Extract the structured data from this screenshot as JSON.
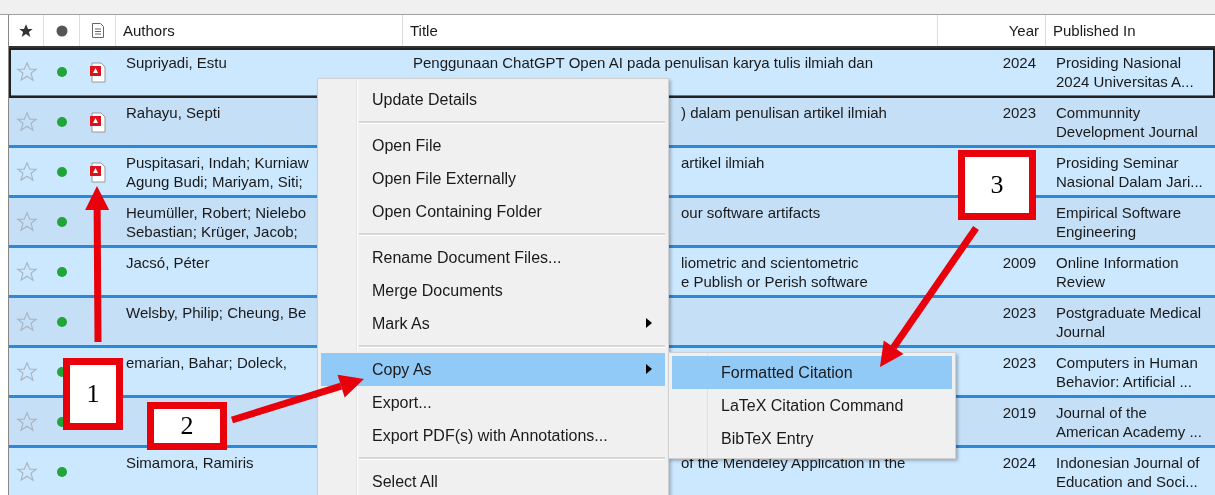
{
  "columns": [
    "Authors",
    "Title",
    "Year",
    "Published In"
  ],
  "rows": [
    {
      "selected": true,
      "focused": true,
      "starred": false,
      "unread": true,
      "pdf": true,
      "authors": "Supriyadi, Estu",
      "title": "Penggunaan ChatGPT Open AI pada penulisan karya tulis ilmiah dan",
      "year": "2024",
      "published_in": "Prosiding Nasional\n2024 Universitas A..."
    },
    {
      "selected": true,
      "focused": false,
      "starred": false,
      "unread": true,
      "pdf": true,
      "authors": "Rahayu, Septi",
      "title": ") dalam penulisan artikel ilmiah",
      "year": "2023",
      "published_in": "Communnity\nDevelopment Journal"
    },
    {
      "selected": true,
      "focused": false,
      "starred": false,
      "unread": true,
      "pdf": true,
      "authors": "Puspitasari, Indah; Kurniaw\nAgung Budi; Mariyam, Siti;",
      "title": "artikel ilmiah",
      "published_in": "Prosiding Seminar\nNasional Dalam Jari..."
    },
    {
      "selected": true,
      "focused": false,
      "starred": false,
      "unread": true,
      "pdf": false,
      "authors": "Heumüller, Robert; Nielebo\nSebastian; Krüger, Jacob;",
      "title": "our software artifacts",
      "published_in": "Empirical Software\nEngineering"
    },
    {
      "selected": true,
      "focused": false,
      "starred": false,
      "unread": true,
      "pdf": false,
      "authors": "Jacsó, Péter",
      "title": "liometric and scientometric\ne Publish or Perish software",
      "year": "2009",
      "published_in": "Online Information\nReview"
    },
    {
      "selected": true,
      "focused": false,
      "starred": false,
      "unread": true,
      "pdf": false,
      "authors": "Welsby, Philip; Cheung, Be",
      "year": "2023",
      "published_in": "Postgraduate Medical\nJournal"
    },
    {
      "selected": true,
      "focused": false,
      "starred": false,
      "unread": true,
      "pdf": false,
      "authors": "emarian, Bahar; Doleck,",
      "year": "2023",
      "published_in": "Computers in Human\nBehavior: Artificial ..."
    },
    {
      "selected": true,
      "focused": false,
      "starred": false,
      "unread": true,
      "pdf": false,
      "year": "2019",
      "published_in": "Journal of the\nAmerican Academy ..."
    },
    {
      "selected": true,
      "focused": false,
      "starred": false,
      "unread": true,
      "pdf": false,
      "authors": "Simamora, Ramiris",
      "title": "of the Mendeley Application in the",
      "year": "2024",
      "published_in": "Indonesian Journal of\nEducation and Soci..."
    }
  ],
  "context_menu": [
    {
      "kind": "item",
      "label": "Update Details",
      "submenu": false,
      "selected": false
    },
    {
      "kind": "separator"
    },
    {
      "kind": "item",
      "label": "Open File",
      "submenu": false,
      "selected": false
    },
    {
      "kind": "item",
      "label": "Open File Externally",
      "submenu": false,
      "selected": false
    },
    {
      "kind": "item",
      "label": "Open Containing Folder",
      "submenu": false,
      "selected": false
    },
    {
      "kind": "separator"
    },
    {
      "kind": "item",
      "label": "Rename Document Files...",
      "submenu": false,
      "selected": false
    },
    {
      "kind": "item",
      "label": "Merge Documents",
      "submenu": false,
      "selected": false
    },
    {
      "kind": "item",
      "label": "Mark As",
      "submenu": true,
      "selected": false
    },
    {
      "kind": "separator"
    },
    {
      "kind": "item",
      "label": "Copy As",
      "submenu": true,
      "selected": true
    },
    {
      "kind": "item",
      "label": "Export...",
      "submenu": false,
      "selected": false
    },
    {
      "kind": "item",
      "label": "Export PDF(s) with Annotations...",
      "submenu": false,
      "selected": false
    },
    {
      "kind": "separator"
    },
    {
      "kind": "item",
      "label": "Select All",
      "submenu": false,
      "selected": false
    }
  ],
  "submenu": [
    {
      "label": "Formatted Citation",
      "selected": true
    },
    {
      "label": "LaTeX Citation Command",
      "selected": false
    },
    {
      "label": "BibTeX Entry",
      "selected": false
    }
  ],
  "callouts": [
    "1",
    "2",
    "3"
  ]
}
